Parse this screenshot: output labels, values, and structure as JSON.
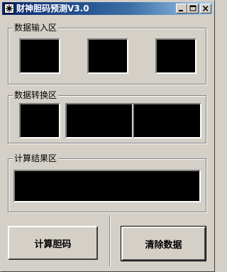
{
  "window": {
    "title": "财神胆码预测V3.0"
  },
  "title_controls": {
    "minimize": "minimize",
    "maximize": "maximize",
    "close": "close"
  },
  "input_group": {
    "label": "数据输入区"
  },
  "convert_group": {
    "label": "数据转换区"
  },
  "result_group": {
    "label": "计算结果区"
  },
  "buttons": {
    "calculate_label": "计算胆码",
    "clear_label": "清除数据"
  },
  "icons": {
    "app": "app-icon",
    "minimize": "minimize-icon",
    "maximize": "maximize-icon",
    "close": "close-icon"
  },
  "colors": {
    "titlebar_start": "#0a246a",
    "titlebar_end": "#a6caf0",
    "face": "#d4d0c8",
    "display": "#000000"
  }
}
